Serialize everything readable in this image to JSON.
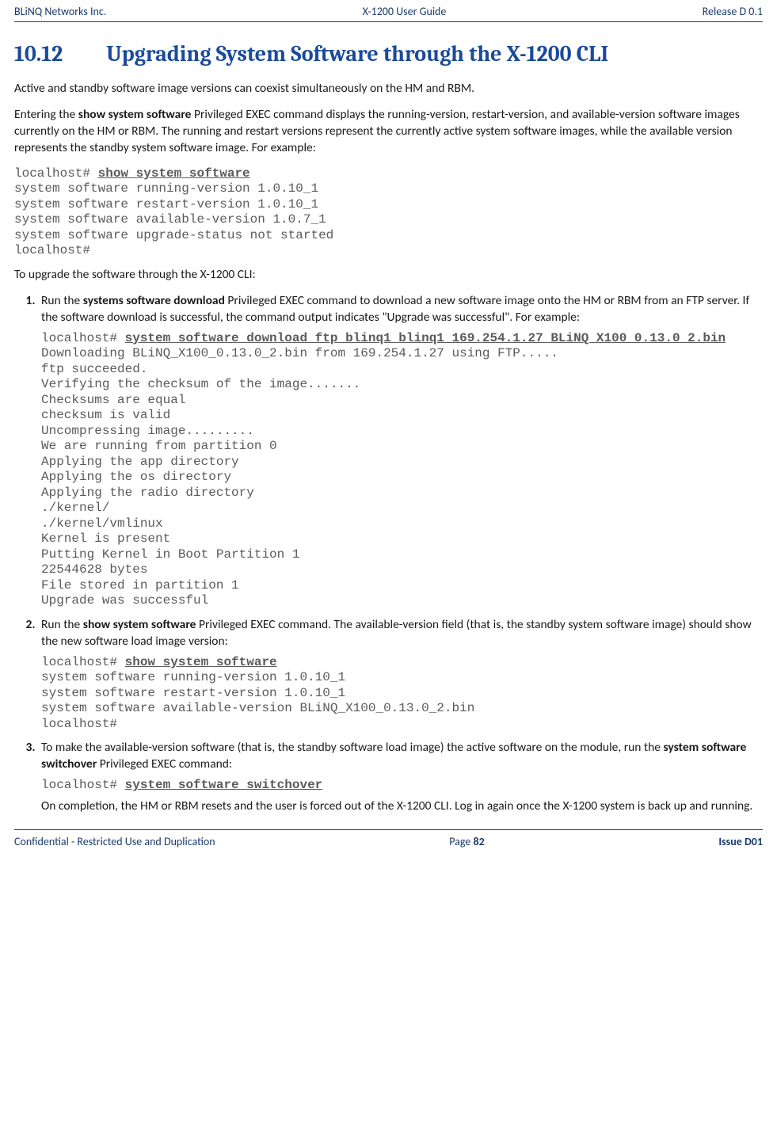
{
  "header": {
    "left": "BLiNQ Networks Inc.",
    "center": "X-1200 User Guide",
    "right": "Release D 0.1"
  },
  "section": {
    "number": "10.12",
    "title": "Upgrading System Software through the X-1200 CLI"
  },
  "intro": {
    "p1": "Active and standby software image versions can coexist simultaneously on the HM and RBM.",
    "p2a": "Entering the ",
    "p2b": "show system software",
    "p2c": " Privileged EXEC command displays the running-version, restart-version, and available-version software images currently on the HM or RBM. The running and restart versions represent the currently active system software images, while the available version represents the standby system software image.  For example:"
  },
  "code1": {
    "prompt": "localhost# ",
    "cmd": "show system software",
    "body": "system software running-version 1.0.10_1\nsystem software restart-version 1.0.10_1\nsystem software available-version 1.0.7_1\nsystem software upgrade-status not started\nlocalhost#"
  },
  "afterCode1": "To upgrade the software through the X-1200 CLI:",
  "step1": {
    "a": "Run the ",
    "b": "systems software download",
    "c": " Privileged EXEC command to download a new software image onto the HM or RBM from an FTP server. If the software download is successful, the command output indicates \"Upgrade was successful\". For example:",
    "codePrompt": "localhost# ",
    "codeCmd": "system software download ftp blinq1 blinq1 169.254.1.27 BLiNQ_X100_0.13.0_2.bin",
    "codeBody": "Downloading BLiNQ_X100_0.13.0_2.bin from 169.254.1.27 using FTP.....\nftp succeeded.\nVerifying the checksum of the image.......\nChecksums are equal\nchecksum is valid\nUncompressing image.........\nWe are running from partition 0\nApplying the app directory\nApplying the os directory\nApplying the radio directory\n./kernel/\n./kernel/vmlinux\nKernel is present\nPutting Kernel in Boot Partition 1\n22544628 bytes\nFile stored in partition 1\nUpgrade was successful"
  },
  "step2": {
    "a": "Run the ",
    "b": "show system software",
    "c": " Privileged EXEC command. The available-version field (that is, the standby system software image) should show the new software load image version:",
    "codePrompt": "localhost# ",
    "codeCmd": "show system software",
    "codeBody": "system software running-version 1.0.10_1\nsystem software restart-version 1.0.10_1\nsystem software available-version BLiNQ_X100_0.13.0_2.bin\nlocalhost#"
  },
  "step3": {
    "a": "To make the available-version software (that is, the standby software load image) the active software on the module, run the ",
    "b": "system software switchover",
    "c": " Privileged EXEC command:",
    "codePrompt": "localhost# ",
    "codeCmd": "system software switchover",
    "after": "On completion, the HM or RBM resets and the user is forced out of the X-1200 CLI.  Log in again once the X-1200 system is back up and running."
  },
  "footer": {
    "left": "Confidential - Restricted Use and Duplication",
    "centerLabel": "Page ",
    "centerNum": "82",
    "right": "Issue D01"
  }
}
